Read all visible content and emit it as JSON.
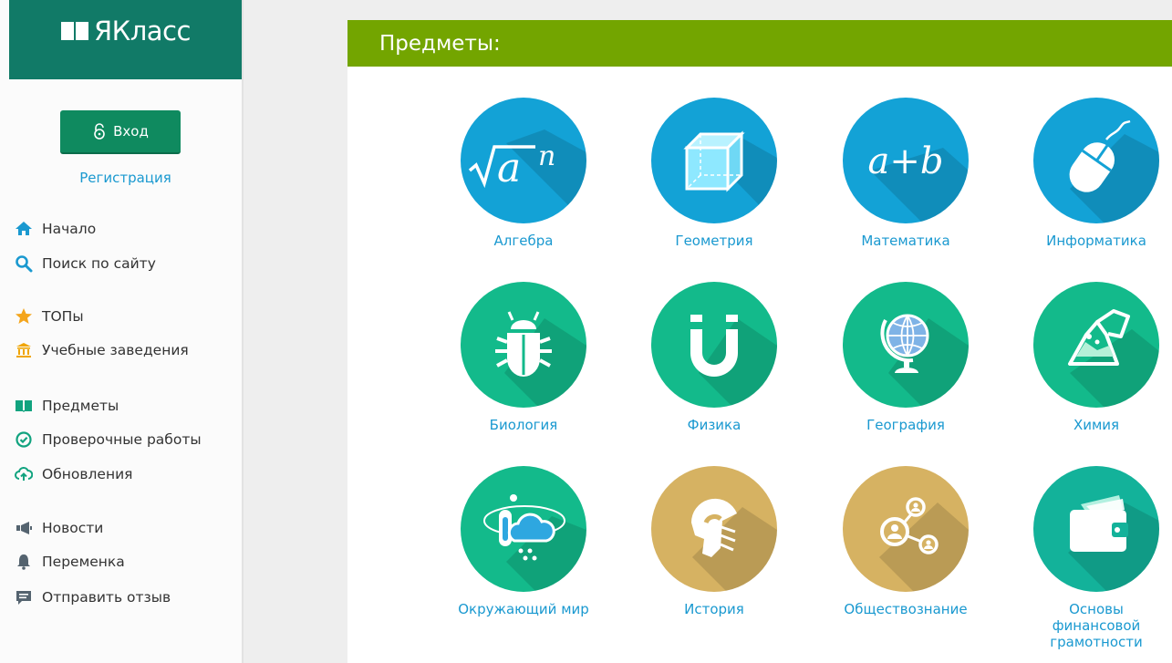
{
  "logo": {
    "text": "ЯКласс"
  },
  "auth": {
    "login_label": "Вход",
    "register_label": "Регистрация"
  },
  "menu": {
    "home": "Начало",
    "search": "Поиск по сайту",
    "tops": "ТОПы",
    "schools": "Учебные заведения",
    "subjects": "Предметы",
    "tests": "Проверочные работы",
    "updates": "Обновления",
    "news": "Новости",
    "break": "Переменка",
    "feedback": "Отправить отзыв"
  },
  "section": {
    "title": "Предметы:"
  },
  "subjects": [
    {
      "label": "Алгебра",
      "icon": "square-root-icon",
      "color": "#13a2d6"
    },
    {
      "label": "Геометрия",
      "icon": "cube-icon",
      "color": "#13a2d6"
    },
    {
      "label": "Математика",
      "icon": "a-plus-b-icon",
      "color": "#13a2d6"
    },
    {
      "label": "Информатика",
      "icon": "mouse-icon",
      "color": "#13a2d6"
    },
    {
      "label": "Биология",
      "icon": "bug-icon",
      "color": "#13ba8b"
    },
    {
      "label": "Физика",
      "icon": "magnet-icon",
      "color": "#13ba8b"
    },
    {
      "label": "География",
      "icon": "globe-icon",
      "color": "#13ba8b"
    },
    {
      "label": "Химия",
      "icon": "flask-icon",
      "color": "#13ba8b"
    },
    {
      "label": "Окружающий мир",
      "icon": "weather-icon",
      "color": "#13ba8b"
    },
    {
      "label": "История",
      "icon": "helmet-icon",
      "color": "#d6b262"
    },
    {
      "label": "Обществознание",
      "icon": "people-network-icon",
      "color": "#d6b262"
    },
    {
      "label": "Основы финансовой грамотности",
      "icon": "wallet-icon",
      "color": "#13b29a"
    }
  ]
}
